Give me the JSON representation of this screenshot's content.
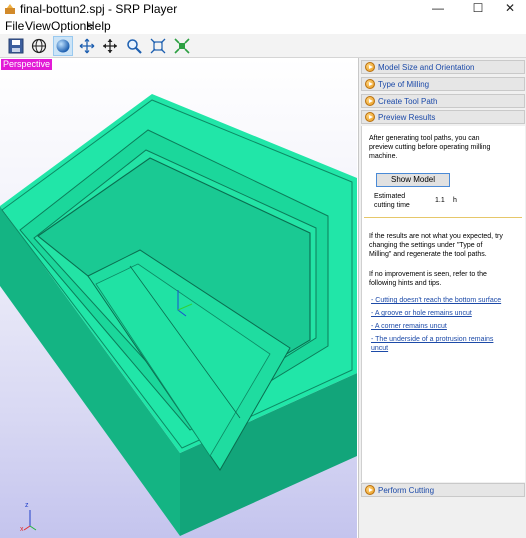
{
  "window": {
    "title": "final-bottun2.spj - SRP Player",
    "icon": "srp-app-icon",
    "minimize": "—",
    "maximize": "☐",
    "close": "✕"
  },
  "menu": {
    "items": [
      "File",
      "View",
      "Options",
      "Help"
    ]
  },
  "toolbar": {
    "tools": [
      {
        "name": "save-icon"
      },
      {
        "name": "globe-icon"
      },
      {
        "name": "sphere-icon",
        "active": true
      },
      {
        "name": "rotate-arrows-icon"
      },
      {
        "name": "move-arrows-icon"
      },
      {
        "name": "zoom-icon"
      },
      {
        "name": "fit-view-icon"
      },
      {
        "name": "center-view-icon"
      }
    ]
  },
  "viewport": {
    "view_label": "Perspective",
    "model_color": "#1fe5a6",
    "model_dark": "#12a57a",
    "axis_labels": {
      "z": "z",
      "x": "x"
    }
  },
  "panel": {
    "sections": [
      {
        "label": "Model Size and Orientation"
      },
      {
        "label": "Type of Milling"
      },
      {
        "label": "Create Tool Path"
      },
      {
        "label": "Preview Results"
      }
    ],
    "preview": {
      "intro_lines": [
        "After generating tool paths, you can",
        "preview cutting before operating milling",
        "machine."
      ],
      "show_model_label": "Show Model",
      "estimated_label_lines": [
        "Estimated",
        "cutting time"
      ],
      "time_value": "1.1",
      "time_unit": "h",
      "results_lines": [
        "If the results are not what you expected, try",
        "changing the settings under \"Type of",
        "Milling\" and regenerate the tool paths."
      ],
      "improve_lines": [
        "If no improvement is seen, refer to the",
        "following hints and tips."
      ],
      "hints": [
        "- Cutting doesn't reach the bottom surface",
        "- A groove or hole remains uncut",
        "- A corner remains uncut"
      ],
      "hint_multi": [
        "- The underside of a protrusion remains",
        "uncut"
      ]
    },
    "bottom_section": {
      "label": "Perform Cutting"
    }
  }
}
